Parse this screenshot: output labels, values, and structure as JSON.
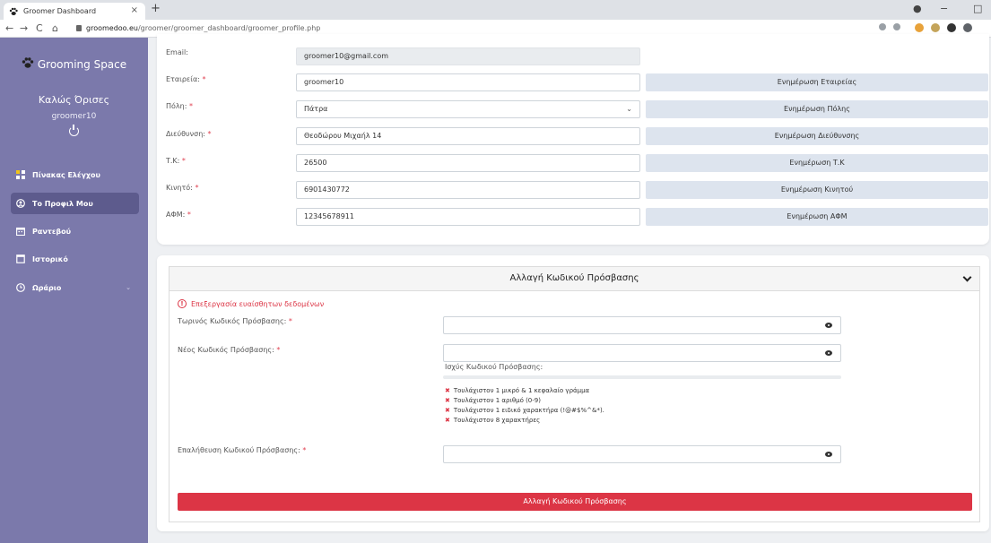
{
  "browser": {
    "tab_title": "Groomer Dashboard",
    "tab_close": "×",
    "new_tab": "+",
    "url_domain": "groomedoo.eu",
    "url_path": "/groomer/groomer_dashboard/groomer_profile.php",
    "back": "←",
    "forward": "→",
    "reload": "C",
    "home": "⌂",
    "minimize": "−",
    "maximize": "□"
  },
  "sidebar": {
    "brand": "Grooming Space",
    "welcome": "Καλώς Όρισες",
    "username": "groomer10",
    "items": [
      {
        "label": "Πίνακας Ελέγχου",
        "icon": "dashboard-icon"
      },
      {
        "label": "Το Προφιλ Μου",
        "icon": "user-circle-icon"
      },
      {
        "label": "Ραντεβού",
        "icon": "calendar-icon"
      },
      {
        "label": "Ιστορικό",
        "icon": "history-icon"
      },
      {
        "label": "Ωράριο",
        "icon": "clock-icon"
      }
    ],
    "chevron": "⌄"
  },
  "profile": {
    "email_label": "Email:",
    "email_value": "groomer10@gmail.com",
    "company_label": "Εταιρεία:",
    "company_value": "groomer10",
    "company_button": "Ενημέρωση Εταιρείας",
    "city_label": "Πόλη:",
    "city_value": "Πάτρα",
    "city_button": "Ενημέρωση Πόλης",
    "address_label": "Διεύθυνση:",
    "address_value": "Θεοδώρου Μιχαήλ 14",
    "address_button": "Ενημέρωση Διεύθυνσης",
    "zip_label": "Τ.Κ:",
    "zip_value": "26500",
    "zip_button": "Ενημέρωση Τ.Κ",
    "mobile_label": "Κινητό:",
    "mobile_value": "6901430772",
    "mobile_button": "Ενημέρωση Κινητού",
    "afm_label": "ΑΦΜ:",
    "afm_value": "12345678911",
    "afm_button": "Ενημέρωση ΑΦΜ",
    "required_mark": "*"
  },
  "password": {
    "title": "Αλλαγή Κωδικού Πρόσβασης",
    "warning": "Επεξεργασία ευαίσθητων δεδομένων",
    "current_label": "Τωρινός Κωδικός Πρόσβασης:",
    "new_label": "Νέος Κωδικός Πρόσβασης:",
    "strength_label": "Ισχύς Κωδικού Πρόσβασης:",
    "strength_level": 0,
    "requirements": [
      "Τουλάχιστον 1 μικρό & 1 κεφαλαίο γράμμα",
      "Τουλάχιστον 1 αριθμό (0-9)",
      "Τουλάχιστον 1 ειδικό χαρακτήρα (!@#$%^&*).",
      "Τουλάχιστον 8 χαρακτήρες"
    ],
    "confirm_label": "Επαλήθευση Κωδικού Πρόσβασης:",
    "submit_label": "Αλλαγή Κωδικού Πρόσβασης"
  },
  "colors": {
    "sidebar": "#7b79ab",
    "sidebar_active": "#5d5b8d",
    "danger": "#dc3545",
    "update_button": "#dde4ee"
  }
}
